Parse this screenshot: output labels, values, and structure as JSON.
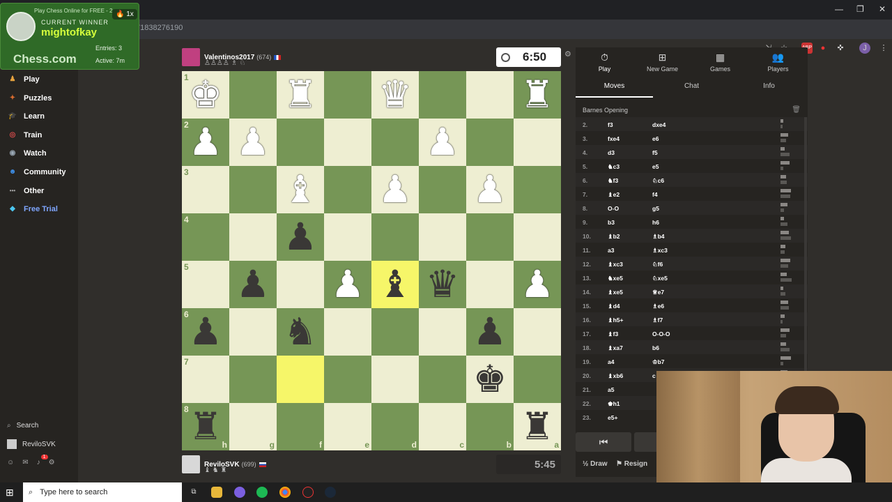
{
  "browser": {
    "tab_title": "Play Chess Online for FREE - 2",
    "url": "m/game/1671838276190",
    "window_controls": {
      "minimize": "—",
      "maximize": "❐",
      "close": "✕"
    },
    "ext_labels": [
      "ABP",
      "●",
      "◆",
      "J"
    ]
  },
  "overlay": {
    "subtitle": "Play Chess Online for FREE - 2",
    "current_winner": "CURRENT WINNER",
    "winner_name": "mightofkay",
    "streak": "1x",
    "streak_icon": "🔥",
    "entries": "Entries: 3",
    "active": "Active: 7m",
    "logo": "Chess.com"
  },
  "sidebar": {
    "items": [
      {
        "label": "Play",
        "icon": "♟",
        "color": "#e7a33e"
      },
      {
        "label": "Puzzles",
        "icon": "✦",
        "color": "#d86b2e"
      },
      {
        "label": "Learn",
        "icon": "🎓",
        "color": "#3ea6e7"
      },
      {
        "label": "Train",
        "icon": "◎",
        "color": "#d94c4c"
      },
      {
        "label": "Watch",
        "icon": "◉",
        "color": "#9aa8b5"
      },
      {
        "label": "Community",
        "icon": "☻",
        "color": "#3e8ee7"
      },
      {
        "label": "Other",
        "icon": "•••",
        "color": "#aaaaaa"
      },
      {
        "label": "Free Trial",
        "icon": "◆",
        "color": "#4cc6f0"
      }
    ],
    "search": "Search",
    "username": "RevilоSVK",
    "notification_count": "1"
  },
  "top_player": {
    "name": "Valentinos2017",
    "rating": "(674)",
    "flag_color": "#3060c0",
    "captured": "♙♙♙♙ ♗ ♘"
  },
  "bottom_player": {
    "name": "RevilоSVK",
    "rating": "(699)",
    "captured": "♝ ♞ ♜"
  },
  "clocks": {
    "top": "6:50",
    "bottom": "5:45"
  },
  "board": {
    "ranks": [
      "1",
      "2",
      "3",
      "4",
      "5",
      "6",
      "7",
      "8"
    ],
    "files": [
      "h",
      "g",
      "f",
      "e",
      "d",
      "c",
      "b",
      "a"
    ],
    "highlights": [
      [
        6,
        2
      ],
      [
        4,
        4
      ]
    ],
    "pieces": [
      {
        "row": 0,
        "col": 0,
        "glyph": "♚",
        "side": "w"
      },
      {
        "row": 0,
        "col": 2,
        "glyph": "♜",
        "side": "w"
      },
      {
        "row": 0,
        "col": 4,
        "glyph": "♛",
        "side": "w"
      },
      {
        "row": 0,
        "col": 7,
        "glyph": "♜",
        "side": "w"
      },
      {
        "row": 1,
        "col": 0,
        "glyph": "♟",
        "side": "w"
      },
      {
        "row": 1,
        "col": 1,
        "glyph": "♟",
        "side": "w"
      },
      {
        "row": 1,
        "col": 5,
        "glyph": "♟",
        "side": "w"
      },
      {
        "row": 2,
        "col": 2,
        "glyph": "♝",
        "side": "w"
      },
      {
        "row": 2,
        "col": 4,
        "glyph": "♟",
        "side": "w"
      },
      {
        "row": 2,
        "col": 6,
        "glyph": "♟",
        "side": "w"
      },
      {
        "row": 3,
        "col": 2,
        "glyph": "♟",
        "side": "b"
      },
      {
        "row": 4,
        "col": 1,
        "glyph": "♟",
        "side": "b"
      },
      {
        "row": 4,
        "col": 3,
        "glyph": "♟",
        "side": "w"
      },
      {
        "row": 4,
        "col": 4,
        "glyph": "♝",
        "side": "b"
      },
      {
        "row": 4,
        "col": 5,
        "glyph": "♛",
        "side": "b"
      },
      {
        "row": 4,
        "col": 7,
        "glyph": "♟",
        "side": "w"
      },
      {
        "row": 5,
        "col": 0,
        "glyph": "♟",
        "side": "b"
      },
      {
        "row": 5,
        "col": 2,
        "glyph": "♞",
        "side": "b"
      },
      {
        "row": 5,
        "col": 6,
        "glyph": "♟",
        "side": "b"
      },
      {
        "row": 6,
        "col": 6,
        "glyph": "♚",
        "side": "b"
      },
      {
        "row": 7,
        "col": 0,
        "glyph": "♜",
        "side": "b"
      },
      {
        "row": 7,
        "col": 7,
        "glyph": "♜",
        "side": "b"
      }
    ]
  },
  "panel": {
    "tabs": [
      {
        "label": "Play",
        "icon": "⏱"
      },
      {
        "label": "New Game",
        "icon": "⊞"
      },
      {
        "label": "Games",
        "icon": "▦"
      },
      {
        "label": "Players",
        "icon": "👥"
      }
    ],
    "subtabs": [
      "Moves",
      "Chat",
      "Info"
    ],
    "opening": "Barnes Opening",
    "moves": [
      {
        "n": "2.",
        "w": "f3",
        "b": "dxe4"
      },
      {
        "n": "3.",
        "w": "fxe4",
        "b": "e6"
      },
      {
        "n": "4.",
        "w": "d3",
        "b": "f5"
      },
      {
        "n": "5.",
        "w": "♞c3",
        "b": "e5"
      },
      {
        "n": "6.",
        "w": "♞f3",
        "b": "♘c6"
      },
      {
        "n": "7.",
        "w": "♝e2",
        "b": "f4"
      },
      {
        "n": "8.",
        "w": "O-O",
        "b": "g5"
      },
      {
        "n": "9.",
        "w": "b3",
        "b": "h6"
      },
      {
        "n": "10.",
        "w": "♝b2",
        "b": "♗b4"
      },
      {
        "n": "11.",
        "w": "a3",
        "b": "♗xc3"
      },
      {
        "n": "12.",
        "w": "♝xc3",
        "b": "♘f6"
      },
      {
        "n": "13.",
        "w": "♞xe5",
        "b": "♘xe5"
      },
      {
        "n": "14.",
        "w": "♝xe5",
        "b": "♕e7"
      },
      {
        "n": "15.",
        "w": "♝d4",
        "b": "♗e6"
      },
      {
        "n": "16.",
        "w": "♝h5+",
        "b": "♗f7"
      },
      {
        "n": "17.",
        "w": "♝f3",
        "b": "O-O-O"
      },
      {
        "n": "18.",
        "w": "♝xa7",
        "b": "b6"
      },
      {
        "n": "19.",
        "w": "a4",
        "b": "♔b7"
      },
      {
        "n": "20.",
        "w": "♝xb6",
        "b": "c"
      },
      {
        "n": "21.",
        "w": "a5",
        "b": ""
      },
      {
        "n": "22.",
        "w": "♚h1",
        "b": ""
      },
      {
        "n": "23.",
        "w": "e5+",
        "b": ""
      }
    ],
    "nav_first": "⏮",
    "nav_prev": "<",
    "draw_label": "Draw",
    "draw_icon": "½",
    "resign_label": "Resign",
    "resign_icon": "⚑"
  },
  "taskbar": {
    "search_placeholder": "Type here to search",
    "start_icon": "⊞"
  }
}
